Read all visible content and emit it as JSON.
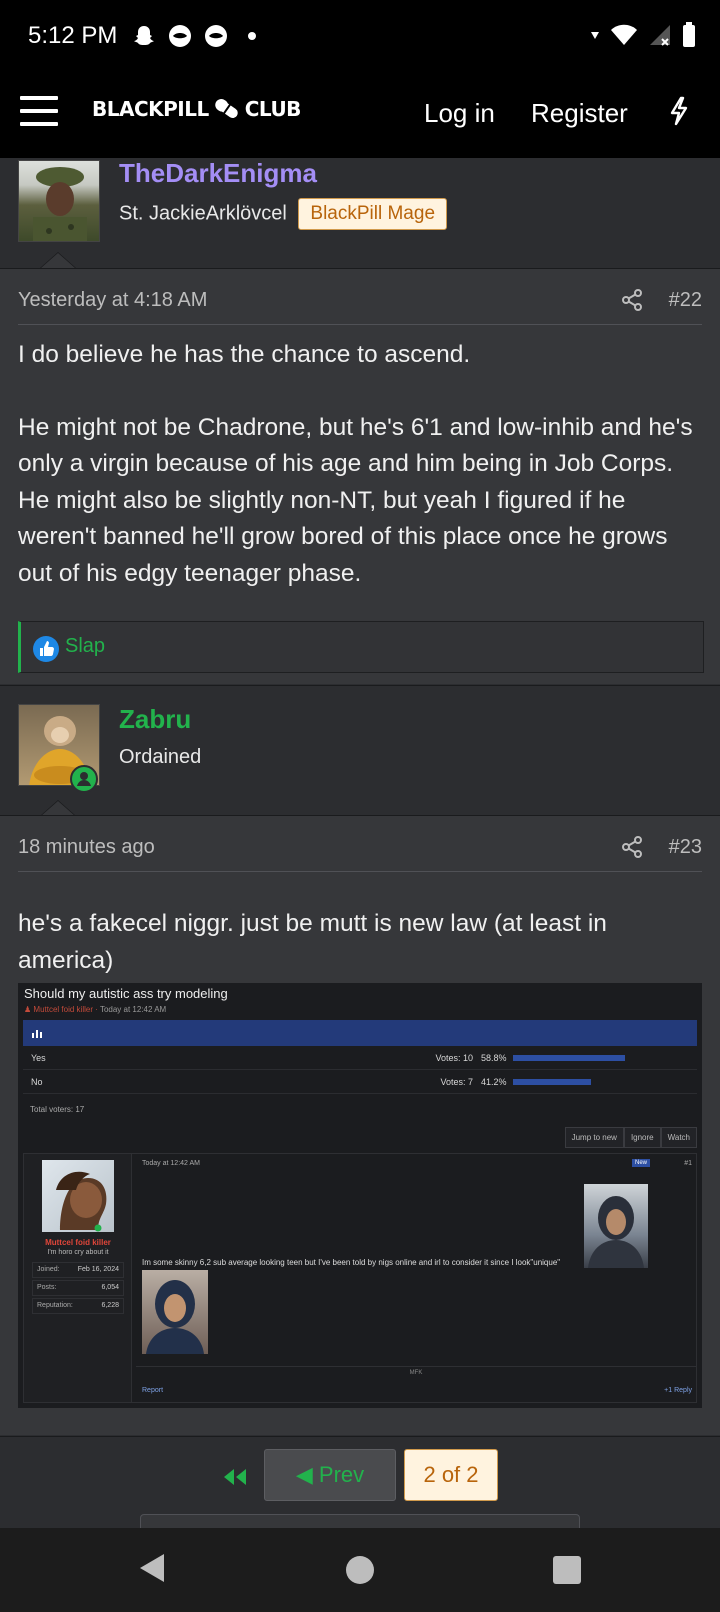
{
  "status_bar": {
    "time": "5:12 PM",
    "icons": [
      "snapchat-icon",
      "notification-icon",
      "notification-icon",
      "dot-icon"
    ],
    "right_icons": [
      "data-arrow-icon",
      "wifi-icon",
      "signal-icon",
      "battery-icon"
    ]
  },
  "nav": {
    "logo_left": "BLACKPILL",
    "logo_right": "CLUB",
    "login": "Log in",
    "register": "Register",
    "quick_icon": "bolt-icon"
  },
  "posts": [
    {
      "username": "TheDarkEnigma",
      "username_color": "#a48ef5",
      "user_title": "St. JackieArklövcel",
      "banner": "BlackPill Mage",
      "date": "Yesterday at 4:18 AM",
      "number": "#22",
      "message": [
        "I do believe he has the chance to ascend.",
        "He might not be Chadrone, but he's 6'1 and low-inhib and he's only a virgin because of his age and him being in Job Corps. He might also be slightly non-NT, but yeah I figured if he weren't banned he'll grow bored of this place once he grows out of his edgy teenager phase."
      ],
      "reaction": "Slap"
    },
    {
      "username": "Zabru",
      "username_color": "#22b24c",
      "user_title": "Ordained",
      "date": "18 minutes ago",
      "number": "#23",
      "message": [
        "he's a fakecel niggr. just be mutt is new law (at least in america)"
      ],
      "embedded": {
        "title": "Should my autistic ass try modeling",
        "author": "Muttcel foid killer",
        "posted": "Today at 12:42 AM",
        "poll_icon": "chart-icon",
        "poll": [
          {
            "label": "Yes",
            "votes": "Votes: 10",
            "pct": "58.8%",
            "fraction": 0.588
          },
          {
            "label": "No",
            "votes": "Votes: 7",
            "pct": "41.2%",
            "fraction": 0.412
          }
        ],
        "total": "Total voters: 17",
        "buttons": [
          "Jump to new",
          "Ignore",
          "Watch"
        ],
        "post_user": "Muttcel foid killer",
        "post_user_title": "I'm horo cry about it",
        "stats": [
          {
            "k": "Joined:",
            "v": "Feb 16, 2024"
          },
          {
            "k": "Posts:",
            "v": "6,054"
          },
          {
            "k": "Reputation:",
            "v": "6,228"
          }
        ],
        "post_date": "Today at 12:42 AM",
        "new_badge": "New",
        "post_num": "#1",
        "post_text": "Im some skinny 6,2 sub average looking teen but I've been told by nigs online and irl to consider it since I look\"unique\"",
        "signature": "MFK",
        "report": "Report",
        "reply": "+1   Reply"
      }
    }
  ],
  "pagination": {
    "prev": "Prev",
    "current": "2 of 2"
  }
}
